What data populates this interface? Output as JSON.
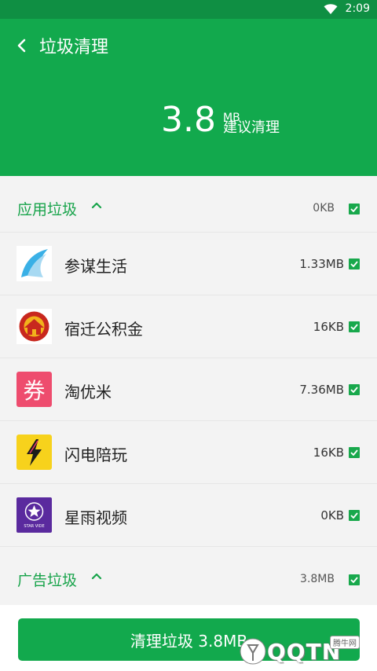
{
  "status_bar": {
    "time": "2:09",
    "wifi_icon": "wifi-icon"
  },
  "header": {
    "title": "垃圾清理",
    "back_icon": "chevron-left-icon",
    "junk_value": "3.8",
    "junk_unit": "MB",
    "advice": "建议清理"
  },
  "colors": {
    "primary": "#12a94d",
    "status_bar": "#0f8f43",
    "accent_text": "#17a34a",
    "check": "#18a84c"
  },
  "sections": [
    {
      "title": "应用垃圾",
      "size": "0KB",
      "expanded": true,
      "checked": true,
      "apps": [
        {
          "name": "参谋生活",
          "size": "1.33MB",
          "icon": "canmou-app-icon",
          "checked": true
        },
        {
          "name": "宿迁公积金",
          "size": "16KB",
          "icon": "suqian-gjj-app-icon",
          "checked": true
        },
        {
          "name": "淘优米",
          "size": "7.36MB",
          "icon": "taoyoumi-app-icon",
          "icon_text": "券",
          "checked": true
        },
        {
          "name": "闪电陪玩",
          "size": "16KB",
          "icon": "lightning-app-icon",
          "checked": true
        },
        {
          "name": "星雨视频",
          "size": "0KB",
          "icon": "star-video-app-icon",
          "icon_text": "STAR VIDE",
          "checked": true
        }
      ]
    },
    {
      "title": "广告垃圾",
      "size": "3.8MB",
      "expanded": true,
      "checked": true
    }
  ],
  "clean_button": {
    "label": "清理垃圾 3.8MB"
  },
  "watermark": {
    "logo_text": "QQTN",
    "tag": "腾牛网"
  }
}
